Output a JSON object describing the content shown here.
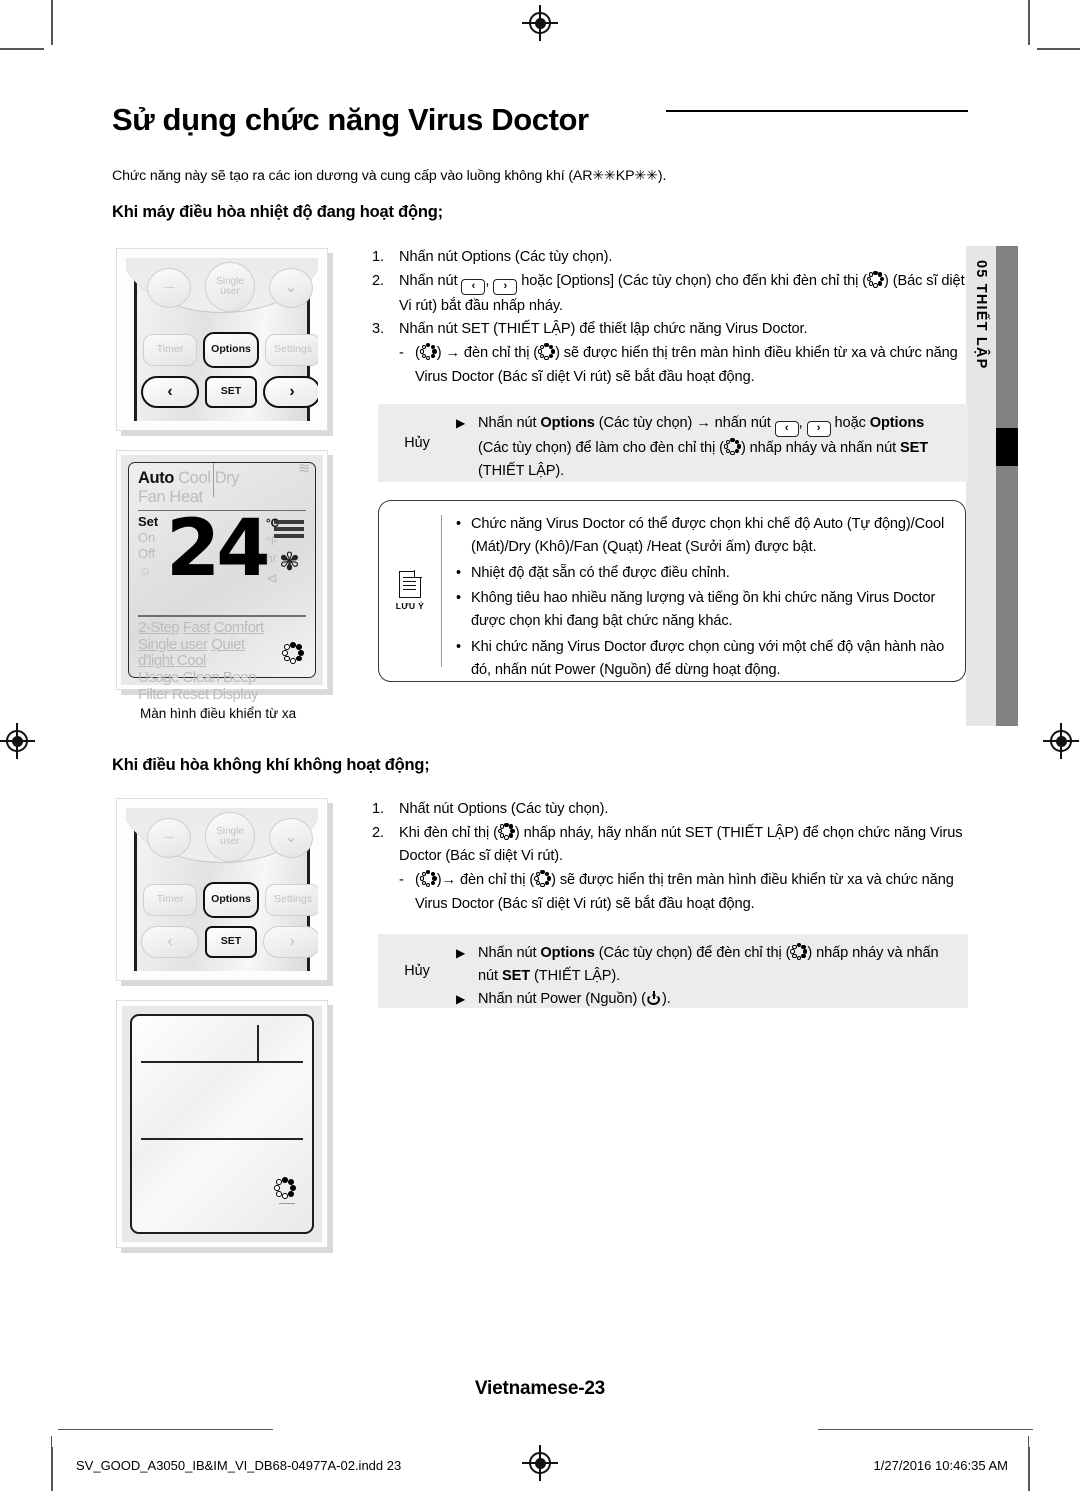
{
  "header": {
    "title": "Sử dụng chức năng Virus Doctor",
    "intro": "Chức năng này sẽ tạo ra các ion dương và cung cấp vào luồng không khí (AR✳✳KP✳✳)."
  },
  "side_tab": {
    "text": "05  THIẾT LẬP"
  },
  "section1": {
    "heading": "Khi máy điều hòa nhiệt độ đang hoạt động;",
    "steps": [
      {
        "num": "1.",
        "text": "Nhấn nút Options (Các tùy chọn)."
      },
      {
        "num": "2.",
        "text_a": "Nhấn nút ",
        "text_b": ", ",
        "text_c": " hoặc [Options] (Các tùy chọn) cho đến khi đèn chỉ thị (",
        "text_d": ") (Bác sĩ diệt Vi rút) bắt đầu nhấp nháy."
      },
      {
        "num": "3.",
        "text": "Nhấn nút SET (THIẾT LẬP) để thiết lập chức năng Virus Doctor."
      }
    ],
    "sub_step": {
      "dash": "-",
      "text_a": "(",
      "text_b": ") → đèn chỉ thị (",
      "text_c": ") sẽ được hiển thị trên màn hình điều khiển từ xa và chức năng Virus Doctor (Bác sĩ diệt Vi rút) sẽ bắt đầu hoạt động."
    },
    "cancel_box": {
      "label": "Hủy",
      "triangle": "▶",
      "item_a": "Nhấn nút ",
      "item_bold1": "Options",
      "item_b": " (Các tùy chọn) → nhấn nút ",
      "item_c": ", ",
      "item_d": " hoặc ",
      "item_bold2": "Options",
      "item_e": " (Các tùy chọn) để làm cho đèn chỉ thị (",
      "item_f": ") nhấp nháy và nhấn nút ",
      "item_bold3": "SET",
      "item_g": " (THIẾT LẬP)."
    },
    "note_box": {
      "label": "LƯU Ý",
      "bullet": "•",
      "items": [
        "Chức năng Virus Doctor có thể được chọn khi chế độ Auto (Tự động)/Cool (Mát)/Dry (Khô)/Fan (Quạt) /Heat (Sưởi ấm) được bật.",
        "Nhiệt độ đặt sẵn có thể được điều chỉnh.",
        "Không tiêu hao nhiều năng lượng và tiếng ồn khi chức năng Virus Doctor được chọn khi đang bật chức năng khác.",
        "Khi chức năng Virus Doctor được chọn cùng với một chế độ vận hành nào đó, nhấn nút Power (Nguồn) để dừng hoạt động."
      ]
    },
    "illustration_caption": "Màn hình điều khiển từ xa"
  },
  "section2": {
    "heading": "Khi điều hòa không khí không hoạt động;",
    "steps": [
      {
        "num": "1.",
        "text": "Nhất nút Options (Các tùy chọn)."
      },
      {
        "num": "2.",
        "text_a": "Khi đèn chỉ thị (",
        "text_b": ") nhấp nháy, hãy nhấn nút SET (THIẾT LẬP) để chọn chức năng Virus Doctor (Bác sĩ diệt Vi rút)."
      }
    ],
    "sub_step": {
      "dash": "-",
      "text_a": "(",
      "text_b": ")→ đèn chỉ thị (",
      "text_c": ") sẽ được hiển thị trên màn hình điều khiển từ xa và chức năng Virus Doctor (Bác sĩ diệt Vi rút) sẽ bắt đầu hoạt động."
    },
    "cancel_box": {
      "label": "Hủy",
      "triangle": "▶",
      "row1_a": "Nhấn nút ",
      "row1_bold1": "Options",
      "row1_b": " (Các tùy chọn) để đèn chỉ thị (",
      "row1_c": ") nhấp nháy và nhấn nút ",
      "row1_bold2": "SET",
      "row1_d": " (THIẾT LẬP).",
      "row2_a": "Nhấn nút Power (Nguồn) (",
      "row2_b": ")."
    }
  },
  "remote": {
    "buttons": {
      "minus": "—",
      "single_user": "Single\nuser",
      "chevron_down": "⌄",
      "timer": "Timer",
      "options": "Options",
      "settings": "Settings",
      "left": "‹",
      "set": "SET",
      "right": "›"
    }
  },
  "lcd": {
    "row1": {
      "auto": "Auto",
      "cool": "Cool",
      "dry": "Dry",
      "fan": "Fan",
      "heat": "Heat"
    },
    "left_labels": [
      "Set",
      "On",
      "Off"
    ],
    "temperature": "24",
    "units": [
      "°C",
      "°F",
      "hr"
    ],
    "row3": [
      "2-Step",
      "Fast",
      "Comfort",
      "Single user",
      "Quiet",
      "d'light Cool",
      "Usage",
      "Clean",
      "Beep",
      "Filter Reset",
      "Display"
    ]
  },
  "footer": {
    "page_label": "Vietnamese-23",
    "file_name": "SV_GOOD_A3050_IB&IM_VI_DB68-04977A-02.indd   23",
    "timestamp": "1/27/2016   10:46:35 AM"
  },
  "colors": {
    "gray_box": "#ececed",
    "side_tab_light": "#e6e6e6",
    "side_tab_dark": "#828282",
    "side_tab_black": "#000000"
  }
}
